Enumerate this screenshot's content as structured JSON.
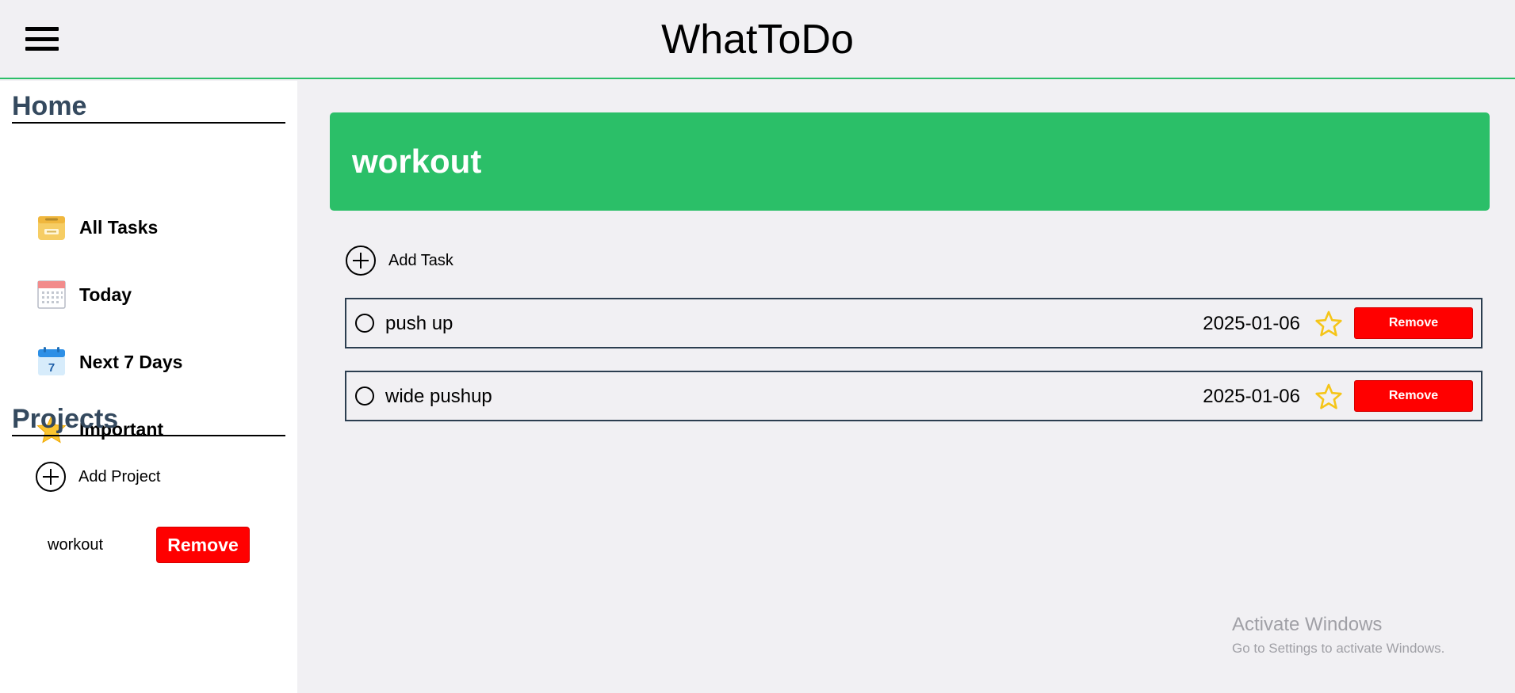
{
  "header": {
    "title": "WhatToDo",
    "menu_icon": "hamburger-menu-icon"
  },
  "sidebar": {
    "home_title": "Home",
    "items": [
      {
        "label": "All Tasks",
        "icon": "archive-box-icon"
      },
      {
        "label": "Today",
        "icon": "calendar-icon"
      },
      {
        "label": "Next 7 Days",
        "icon": "calendar-7-icon",
        "icon_text": "7"
      },
      {
        "label": "Important",
        "icon": "star-icon"
      }
    ],
    "projects_title": "Projects",
    "add_project_label": "Add Project",
    "projects": [
      {
        "name": "workout",
        "remove_label": "Remove"
      }
    ]
  },
  "main": {
    "project_title": "workout",
    "add_task_label": "Add Task",
    "tasks": [
      {
        "name": "push up",
        "date": "2025-01-06",
        "important": false,
        "remove_label": "Remove"
      },
      {
        "name": "wide pushup",
        "date": "2025-01-06",
        "important": false,
        "remove_label": "Remove"
      }
    ]
  },
  "watermark": {
    "title": "Activate Windows",
    "subtitle": "Go to Settings to activate Windows."
  },
  "colors": {
    "accent": "#2bbf68",
    "danger": "#ff0000",
    "heading": "#34495e",
    "star": "#f5c518"
  }
}
